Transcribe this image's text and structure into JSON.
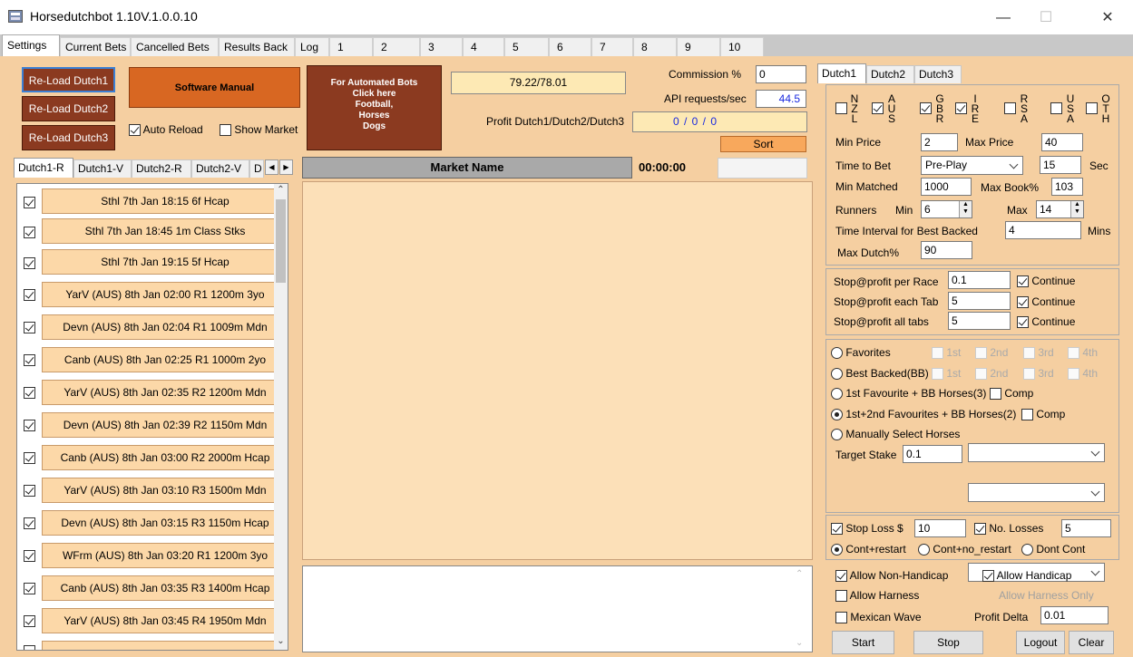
{
  "window": {
    "title": "Horsedutchbot 1.10V.1.0.0.10",
    "minimize": "—",
    "maximize": "☐",
    "close": "✕"
  },
  "top_tabs": [
    "Settings",
    "Current Bets",
    "Cancelled Bets",
    "Results Back",
    "Log"
  ],
  "num_tabs": [
    "1",
    "2",
    "3",
    "4",
    "5",
    "6",
    "7",
    "8",
    "9",
    "10"
  ],
  "buttons": {
    "reload1": "Re-Load Dutch1",
    "reload2": "Re-Load Dutch2",
    "reload3": "Re-Load Dutch3",
    "manual": "Software Manual",
    "automated_line1": "For Automated Bots",
    "automated_line2": "Click here",
    "automated_line3": "Football,",
    "automated_line4": "Horses",
    "automated_line5": "Dogs",
    "sort": "Sort",
    "start": "Start",
    "stop": "Stop",
    "logout": "Logout",
    "clear": "Clear"
  },
  "options": {
    "auto_reload": "Auto Reload",
    "show_market": "Show Market"
  },
  "stats": {
    "price": "79.22/78.01",
    "commission_label": "Commission %",
    "commission_value": "0",
    "api_label": "API requests/sec",
    "api_value": "44.5",
    "profit_label": "Profit Dutch1/Dutch2/Dutch3",
    "profit_value": "0 / 0 / 0"
  },
  "market": {
    "header": "Market Name",
    "timer": "00:00:00"
  },
  "list_tabs": [
    "Dutch1-R",
    "Dutch1-V",
    "Dutch2-R",
    "Dutch2-V",
    "D"
  ],
  "races": [
    "Sthl  7th Jan 18:15 6f Hcap",
    "Sthl  7th Jan 18:45 1m Class Stks",
    "Sthl  7th Jan 19:15 5f Hcap",
    "YarV (AUS) 8th Jan 02:00 R1 1200m 3yo",
    "Devn (AUS) 8th Jan 02:04 R1 1009m Mdn",
    "Canb (AUS) 8th Jan 02:25 R1 1000m 2yo",
    "YarV (AUS) 8th Jan 02:35 R2 1200m Mdn",
    "Devn (AUS) 8th Jan 02:39 R2 1150m Mdn",
    "Canb (AUS) 8th Jan 03:00 R2 2000m Hcap",
    "YarV (AUS) 8th Jan 03:10 R3 1500m Mdn",
    "Devn (AUS) 8th Jan 03:15 R3 1150m Hcap",
    "WFrm (AUS) 8th Jan 03:20 R1 1200m 3yo",
    "Canb (AUS) 8th Jan 03:35 R3 1400m Hcap",
    "YarV (AUS) 8th Jan 03:45 R4 1950m Mdn"
  ],
  "dutch_tabs": [
    "Dutch1",
    "Dutch2",
    "Dutch3"
  ],
  "countries": [
    {
      "top": "N",
      "mid": "Z",
      "bot": "L"
    },
    {
      "top": "A",
      "mid": "U",
      "bot": "S"
    },
    {
      "top": "G",
      "mid": "B",
      "bot": "R"
    },
    {
      "top": "I",
      "mid": "R",
      "bot": "E"
    },
    {
      "top": "R",
      "mid": "S",
      "bot": "A"
    },
    {
      "top": "U",
      "mid": "S",
      "bot": "A"
    },
    {
      "top": "O",
      "mid": "T",
      "bot": "H"
    }
  ],
  "settings": {
    "min_price_label": "Min Price",
    "min_price": "2",
    "max_price_label": "Max Price",
    "max_price": "40",
    "time_to_bet_label": "Time to Bet",
    "time_to_bet": "Pre-Play",
    "time_to_bet_sec": "15",
    "sec_label": "Sec",
    "min_matched_label": "Min Matched",
    "min_matched": "1000",
    "max_book_label": "Max Book%",
    "max_book": "103",
    "runners_label": "Runners",
    "runners_min_label": "Min",
    "runners_min": "6",
    "runners_max_label": "Max",
    "runners_max": "14",
    "interval_label": "Time Interval for Best Backed",
    "interval": "4",
    "mins_label": "Mins",
    "max_dutch_label": "Max Dutch%",
    "max_dutch": "90"
  },
  "stops": {
    "race_label": "Stop@profit per Race",
    "race": "0.1",
    "tab_label": "Stop@profit each Tab",
    "tab": "5",
    "all_label": "Stop@profit all tabs",
    "all": "5",
    "continue": "Continue"
  },
  "selection": {
    "favorites": "Favorites",
    "best_backed": "Best Backed(BB)",
    "fav_bb": "1st Favourite + BB Horses(3)",
    "fav2_bb": "1st+2nd Favourites + BB Horses(2)",
    "manual": "Manually Select Horses",
    "comp": "Comp",
    "target_label": "Target Stake",
    "target": "0.1",
    "places": [
      "1st",
      "2nd",
      "3rd",
      "4th"
    ]
  },
  "loss": {
    "stop_loss_label": "Stop Loss $",
    "stop_loss": "10",
    "no_losses_label": "No. Losses",
    "no_losses": "5",
    "cont_restart": "Cont+restart",
    "cont_no_restart": "Cont+no_restart",
    "dont_cont": "Dont Cont"
  },
  "allow": {
    "non_handicap": "Allow Non-Handicap",
    "handicap": "Allow Handicap",
    "harness": "Allow Harness",
    "harness_only": "Allow Harness Only",
    "mexican": "Mexican Wave",
    "profit_delta_label": "Profit Delta",
    "profit_delta": "0.01"
  },
  "colors": {
    "accent_orange": "#d86722",
    "dark_brown": "#8b3a20",
    "panel_bg": "#f5cfa1",
    "blue_text": "#1a2adf"
  }
}
